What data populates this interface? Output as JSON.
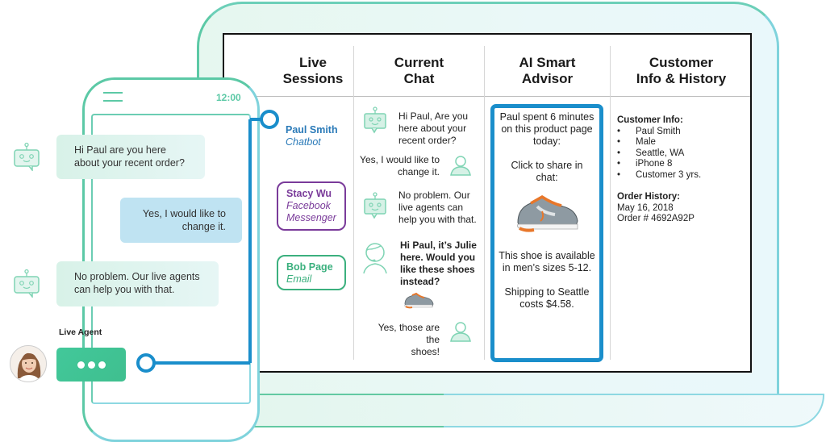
{
  "phone": {
    "clock": "12:00",
    "messages": [
      {
        "from": "bot",
        "text_line1": "Hi Paul are you here",
        "text_line2": "about your recent order?"
      },
      {
        "from": "user",
        "text_line1": "Yes, I would like to",
        "text_line2": "change it."
      },
      {
        "from": "bot",
        "text_line1": "No problem. Our live agents",
        "text_line2": "can help you with that."
      }
    ],
    "live_agent_label": "Live Agent",
    "typing_indicator": "typing-dots"
  },
  "dashboard": {
    "columns": {
      "live_sessions": {
        "title_line1": "Live",
        "title_line2": "Sessions"
      },
      "current_chat": {
        "title_line1": "Current",
        "title_line2": "Chat"
      },
      "ai_advisor": {
        "title_line1": "AI Smart",
        "title_line2": "Advisor"
      },
      "customer": {
        "title_line1": "Customer",
        "title_line2": "Info & History"
      }
    },
    "sessions": [
      {
        "name": "Paul Smith",
        "channel": "Chatbot",
        "color": "#2a7ab8"
      },
      {
        "name": "Stacy Wu",
        "channel_line1": "Facebook",
        "channel_line2": "Messenger",
        "color": "#7a3b9a"
      },
      {
        "name": "Bob Page",
        "channel": "Email",
        "color": "#3bb07e"
      }
    ],
    "chat": [
      {
        "from": "bot",
        "lines": [
          "Hi Paul, Are you",
          "here about your",
          "recent order?"
        ]
      },
      {
        "from": "user",
        "lines": [
          "Yes, I would like to",
          "change it."
        ]
      },
      {
        "from": "bot",
        "lines": [
          "No problem. Our",
          "live agents can",
          "help you with that."
        ]
      },
      {
        "from": "agent",
        "lines": [
          "Hi Paul, it’s Julie",
          "here. Would you",
          "like these shoes",
          "instead?"
        ]
      },
      {
        "from": "user",
        "lines": [
          "Yes, those are the",
          "shoes!"
        ]
      }
    ],
    "advisor": {
      "p1_lines": [
        "Paul spent 6 minutes",
        "on this product page",
        "today:"
      ],
      "p2_lines": [
        "Click to share in",
        "chat:"
      ],
      "p3_lines": [
        "This shoe is available",
        "in men’s sizes 5-12."
      ],
      "p4_lines": [
        "Shipping to Seattle",
        "costs $4.58."
      ],
      "border_color": "#1a8ecb"
    },
    "customer": {
      "info_label": "Customer Info:",
      "info_items": [
        "Paul Smith",
        "Male",
        "Seattle, WA",
        "iPhone 8",
        "Customer 3 yrs."
      ],
      "history_label": "Order History:",
      "history_date": "May 16, 2018",
      "history_order": "Order # 4692A92P"
    }
  },
  "colors": {
    "brand_green": "#5cc9a6",
    "connector_blue": "#1a8ecb",
    "user_bubble": "#bfe3f2"
  }
}
